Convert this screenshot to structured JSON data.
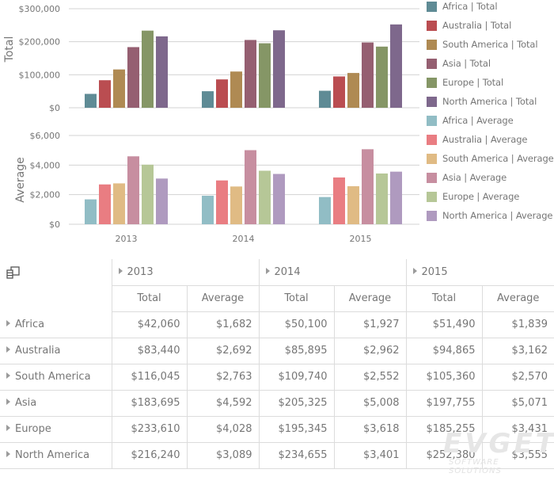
{
  "chart_data": {
    "type": "bar",
    "categories": [
      "2013",
      "2014",
      "2015"
    ],
    "panes": [
      {
        "name": "Total",
        "ylabel": "Total",
        "ylim": [
          0,
          300000
        ],
        "ticks": [
          0,
          100000,
          200000,
          300000
        ],
        "tick_labels": [
          "$0",
          "$100,000",
          "$200,000",
          "$300,000"
        ],
        "grid": true,
        "series": [
          {
            "name": "Africa | Total",
            "color": "#5f8b95",
            "values": [
              42060,
              50100,
              51490
            ]
          },
          {
            "name": "Australia | Total",
            "color": "#ba4d51",
            "values": [
              83440,
              85895,
              94865
            ]
          },
          {
            "name": "South America | Total",
            "color": "#af8a53",
            "values": [
              116045,
              109740,
              105360
            ]
          },
          {
            "name": "Asia | Total",
            "color": "#955f71",
            "values": [
              183695,
              205325,
              197755
            ]
          },
          {
            "name": "Europe | Total",
            "color": "#859666",
            "values": [
              233610,
              195345,
              185255
            ]
          },
          {
            "name": "North America | Total",
            "color": "#7e688c",
            "values": [
              216240,
              234655,
              252380
            ]
          }
        ]
      },
      {
        "name": "Average",
        "ylabel": "Average",
        "ylim": [
          0,
          6000
        ],
        "ticks": [
          0,
          2000,
          4000,
          6000
        ],
        "tick_labels": [
          "$0",
          "$2,000",
          "$4,000",
          "$6,000"
        ],
        "grid": true,
        "series": [
          {
            "name": "Africa | Average",
            "color": "#91bdc5",
            "values": [
              1682,
              1927,
              1839
            ]
          },
          {
            "name": "Australia | Average",
            "color": "#e97d82",
            "values": [
              2692,
              2962,
              3162
            ]
          },
          {
            "name": "South America | Average",
            "color": "#e0bb84",
            "values": [
              2763,
              2552,
              2570
            ]
          },
          {
            "name": "Asia | Average",
            "color": "#c78ea0",
            "values": [
              4592,
              5008,
              5071
            ]
          },
          {
            "name": "Europe | Average",
            "color": "#b6c797",
            "values": [
              4028,
              3618,
              3431
            ]
          },
          {
            "name": "North America | Average",
            "color": "#af9abf",
            "values": [
              3089,
              3401,
              3555
            ]
          }
        ]
      }
    ],
    "legend_position": "right"
  },
  "legend": {
    "items": [
      "Africa | Total",
      "Australia | Total",
      "South America | Total",
      "Asia | Total",
      "Europe | Total",
      "North America | Total",
      "Africa | Average",
      "Australia | Average",
      "South America | Average",
      "Asia | Average",
      "Europe | Average",
      "North America | Average"
    ]
  },
  "pivot": {
    "field_chooser_icon": "field-chooser-icon",
    "years": [
      "2013",
      "2014",
      "2015"
    ],
    "measures": [
      "Total",
      "Average"
    ],
    "rows": [
      {
        "label": "Africa",
        "cells": [
          "$42,060",
          "$1,682",
          "$50,100",
          "$1,927",
          "$51,490",
          "$1,839"
        ]
      },
      {
        "label": "Australia",
        "cells": [
          "$83,440",
          "$2,692",
          "$85,895",
          "$2,962",
          "$94,865",
          "$3,162"
        ]
      },
      {
        "label": "South America",
        "cells": [
          "$116,045",
          "$2,763",
          "$109,740",
          "$2,552",
          "$105,360",
          "$2,570"
        ]
      },
      {
        "label": "Asia",
        "cells": [
          "$183,695",
          "$4,592",
          "$205,325",
          "$5,008",
          "$197,755",
          "$5,071"
        ]
      },
      {
        "label": "Europe",
        "cells": [
          "$233,610",
          "$4,028",
          "$195,345",
          "$3,618",
          "$185,255",
          "$3,431"
        ]
      },
      {
        "label": "North America",
        "cells": [
          "$216,240",
          "$3,089",
          "$234,655",
          "$3,401",
          "$252,380",
          "$3,555"
        ]
      }
    ]
  },
  "watermark": {
    "main": "EVGET",
    "sub": "SOFTWARE SOLUTIONS"
  }
}
